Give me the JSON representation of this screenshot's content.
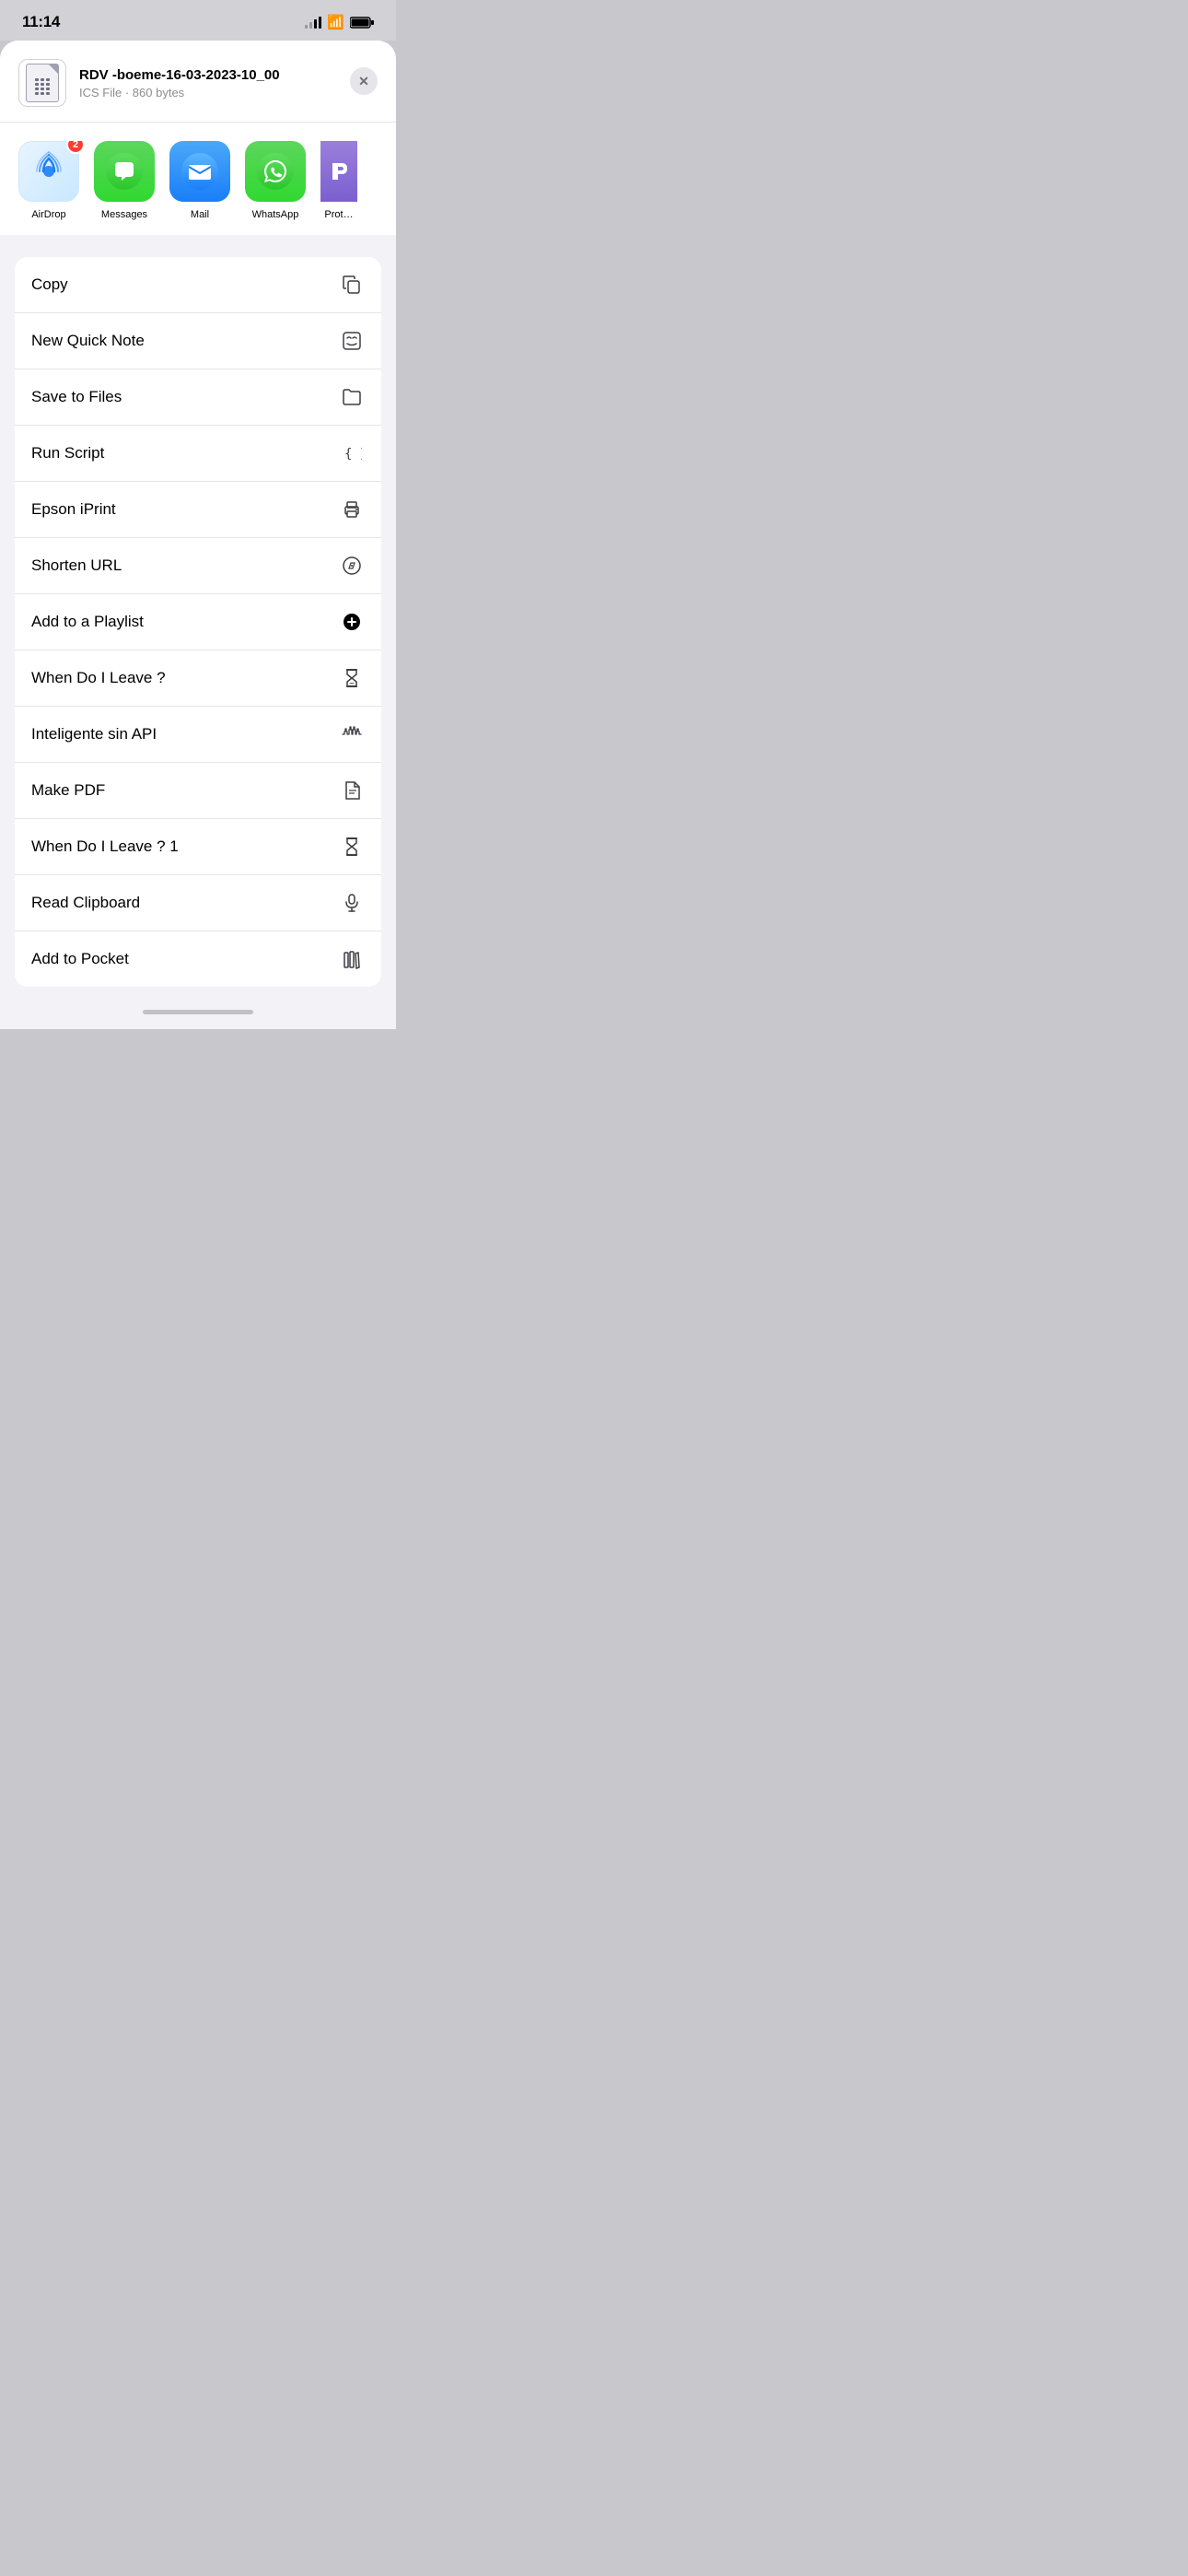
{
  "statusBar": {
    "time": "11:14",
    "battery": "full"
  },
  "fileHeader": {
    "fileName": "RDV -boeme-16-03-2023-10_00",
    "fileType": "ICS File",
    "fileSize": "860 bytes",
    "closeLabel": "✕"
  },
  "apps": [
    {
      "id": "airdrop",
      "label": "AirDrop",
      "badge": "2"
    },
    {
      "id": "messages",
      "label": "Messages",
      "badge": null
    },
    {
      "id": "mail",
      "label": "Mail",
      "badge": null
    },
    {
      "id": "whatsapp",
      "label": "WhatsApp",
      "badge": null
    },
    {
      "id": "proton",
      "label": "Prot…",
      "badge": null
    }
  ],
  "actions": [
    {
      "id": "copy",
      "label": "Copy",
      "icon": "copy"
    },
    {
      "id": "new-quick-note",
      "label": "New Quick Note",
      "icon": "quick-note"
    },
    {
      "id": "save-to-files",
      "label": "Save to Files",
      "icon": "folder"
    },
    {
      "id": "run-script",
      "label": "Run Script",
      "icon": "script"
    },
    {
      "id": "epson-iprint",
      "label": "Epson iPrint",
      "icon": "printer"
    },
    {
      "id": "shorten-url",
      "label": "Shorten URL",
      "icon": "compass"
    },
    {
      "id": "add-to-playlist",
      "label": "Add to a Playlist",
      "icon": "add-circle"
    },
    {
      "id": "when-do-i-leave",
      "label": "When Do I Leave ?",
      "icon": "hourglass"
    },
    {
      "id": "inteligente-sin-api",
      "label": "Inteligente sin API",
      "icon": "waveform"
    },
    {
      "id": "make-pdf",
      "label": "Make PDF",
      "icon": "document"
    },
    {
      "id": "when-do-i-leave-1",
      "label": "When Do I Leave ? 1",
      "icon": "hourglass"
    },
    {
      "id": "read-clipboard",
      "label": "Read Clipboard",
      "icon": "microphone"
    },
    {
      "id": "add-to-pocket",
      "label": "Add to Pocket",
      "icon": "books"
    }
  ]
}
